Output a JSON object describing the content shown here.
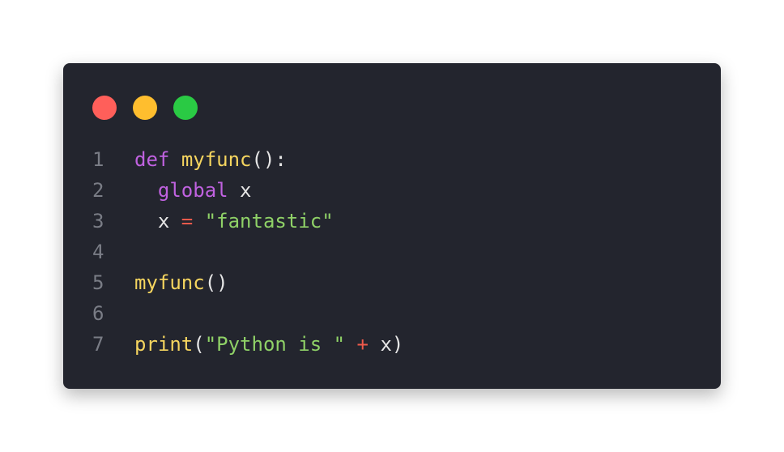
{
  "window": {
    "dots": {
      "red": "#ff5f5a",
      "yellow": "#ffbe2e",
      "green": "#2aca44"
    }
  },
  "code": {
    "lines": [
      {
        "number": "1",
        "tokens": [
          "def",
          " ",
          "myfunc",
          "():"
        ]
      },
      {
        "number": "2",
        "tokens": [
          "  ",
          "global",
          " x"
        ]
      },
      {
        "number": "3",
        "tokens": [
          "  x ",
          "=",
          " ",
          "\"fantastic\""
        ]
      },
      {
        "number": "4",
        "tokens": []
      },
      {
        "number": "5",
        "tokens": [
          "myfunc",
          "()"
        ]
      },
      {
        "number": "6",
        "tokens": []
      },
      {
        "number": "7",
        "tokens": [
          "print",
          "(",
          "\"Python is \"",
          " ",
          "+",
          " x)"
        ]
      }
    ]
  }
}
